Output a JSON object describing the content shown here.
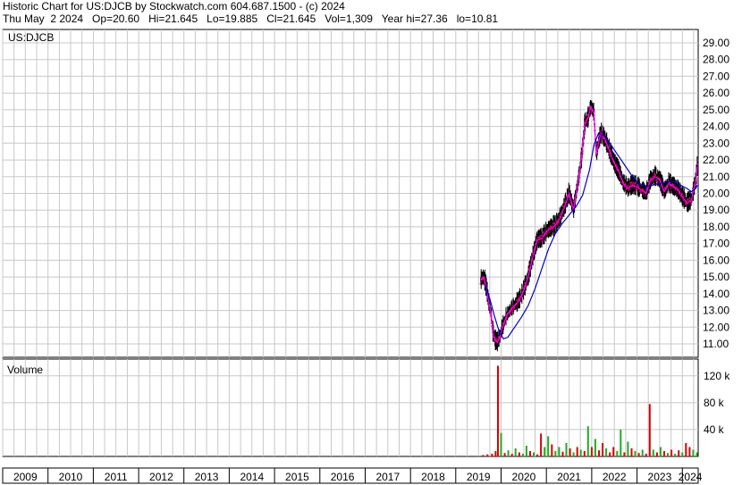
{
  "header": {
    "line1": "Historic Chart for US:DJCB by Stockwatch.com 604.687.1500 - (c) 2024",
    "line2": "Thu May  2 2024   Op=20.60   Hi=21.645   Lo=19.885   Cl=21.645   Vol=1,309   Year hi=27.36   lo=10.81"
  },
  "panels": {
    "price_label": "US:DJCB",
    "volume_label": "Volume"
  },
  "colors": {
    "grid": "#c8c8c8",
    "price_bars": "#000000",
    "close_dots": "#e8007a",
    "moving_avg_short": "#ff00ff",
    "moving_avg_long": "#0000cc",
    "volume_up": "#22aa22",
    "volume_down": "#dd0000"
  },
  "chart_data": [
    {
      "type": "line",
      "title": "",
      "ylabel": "",
      "ylim": [
        10.2,
        29.8
      ],
      "y_ticks": [
        "11.00",
        "12.00",
        "13.00",
        "14.00",
        "15.00",
        "16.00",
        "17.00",
        "18.00",
        "19.00",
        "20.00",
        "21.00",
        "22.00",
        "23.00",
        "24.00",
        "25.00",
        "26.00",
        "27.00",
        "28.00",
        "29.00"
      ],
      "x_ticks": [
        "2009",
        "2010",
        "2011",
        "2012",
        "2013",
        "2014",
        "2015",
        "2016",
        "2017",
        "2018",
        "2019",
        "2020",
        "2021",
        "2022",
        "2023",
        "2024"
      ],
      "xlim": [
        2009.0,
        2024.35
      ],
      "series": [
        {
          "x": [
            2019.55,
            2019.62,
            2019.68,
            2019.72,
            2019.78,
            2019.82,
            2019.87,
            2019.92,
            2019.97,
            2020.02,
            2020.07,
            2020.12,
            2020.2,
            2020.3,
            2020.4,
            2020.5,
            2020.6,
            2020.7,
            2020.8,
            2020.9,
            2021.0,
            2021.1,
            2021.2,
            2021.3,
            2021.4,
            2021.5,
            2021.6,
            2021.7,
            2021.78,
            2021.85,
            2021.92,
            2021.98,
            2022.05,
            2022.1,
            2022.15,
            2022.2,
            2022.3,
            2022.4,
            2022.5,
            2022.6,
            2022.7,
            2022.8,
            2022.9,
            2023.0,
            2023.1,
            2023.2,
            2023.3,
            2023.4,
            2023.5,
            2023.6,
            2023.7,
            2023.8,
            2023.9,
            2024.0,
            2024.1,
            2024.2,
            2024.3,
            2024.33
          ],
          "values": [
            14.8,
            15.0,
            14.3,
            13.6,
            12.8,
            11.7,
            11.2,
            11.1,
            11.4,
            11.9,
            12.3,
            12.7,
            13.0,
            13.3,
            13.6,
            14.2,
            15.0,
            16.2,
            17.2,
            17.3,
            17.7,
            17.9,
            18.1,
            18.5,
            19.2,
            20.0,
            19.0,
            20.7,
            22.2,
            24.2,
            24.5,
            25.2,
            24.8,
            22.3,
            23.0,
            23.6,
            23.2,
            22.5,
            21.8,
            21.3,
            20.6,
            20.3,
            20.5,
            20.4,
            20.2,
            20.0,
            20.8,
            21.0,
            20.8,
            20.1,
            20.6,
            20.4,
            20.2,
            19.8,
            19.4,
            19.6,
            20.8,
            21.6
          ]
        },
        {
          "x": [
            2019.65,
            2019.75,
            2019.85,
            2019.95,
            2020.05,
            2020.15,
            2020.3,
            2020.45,
            2020.6,
            2020.75,
            2020.9,
            2021.05,
            2021.2,
            2021.35,
            2021.5,
            2021.65,
            2021.8,
            2021.95,
            2022.05,
            2022.15,
            2022.3,
            2022.45,
            2022.6,
            2022.75,
            2022.9,
            2023.05,
            2023.2,
            2023.35,
            2023.5,
            2023.65,
            2023.8,
            2023.95,
            2024.1,
            2024.2,
            2024.3,
            2024.33
          ],
          "values": [
            14.5,
            13.7,
            12.7,
            11.8,
            11.3,
            11.4,
            12.0,
            12.6,
            13.3,
            14.3,
            15.5,
            16.7,
            17.6,
            18.2,
            18.7,
            19.2,
            19.9,
            21.4,
            22.9,
            23.6,
            23.4,
            22.8,
            22.2,
            21.6,
            21.0,
            20.6,
            20.4,
            20.5,
            20.6,
            20.7,
            20.7,
            20.5,
            20.3,
            20.1,
            20.3,
            20.5
          ]
        }
      ]
    },
    {
      "type": "bar",
      "title": "",
      "ylabel": "",
      "ylim": [
        0,
        145
      ],
      "y_ticks": [
        "40 k",
        "80 k",
        "120 k"
      ],
      "x": [
        2019.6,
        2019.7,
        2019.8,
        2019.88,
        2019.93,
        2020.0,
        2020.08,
        2020.16,
        2020.24,
        2020.32,
        2020.4,
        2020.48,
        2020.56,
        2020.64,
        2020.72,
        2020.8,
        2020.88,
        2020.96,
        2021.04,
        2021.12,
        2021.2,
        2021.28,
        2021.36,
        2021.44,
        2021.52,
        2021.6,
        2021.68,
        2021.76,
        2021.84,
        2021.92,
        2022.0,
        2022.08,
        2022.16,
        2022.24,
        2022.32,
        2022.4,
        2022.48,
        2022.56,
        2022.64,
        2022.72,
        2022.8,
        2022.88,
        2022.96,
        2023.04,
        2023.12,
        2023.2,
        2023.28,
        2023.36,
        2023.44,
        2023.52,
        2023.6,
        2023.68,
        2023.76,
        2023.84,
        2023.92,
        2024.0,
        2024.08,
        2024.16,
        2024.24,
        2024.32
      ],
      "values": [
        2,
        3,
        4,
        8,
        135,
        35,
        5,
        9,
        4,
        12,
        6,
        4,
        16,
        8,
        6,
        3,
        34,
        14,
        30,
        18,
        8,
        14,
        7,
        20,
        12,
        6,
        14,
        10,
        8,
        45,
        14,
        26,
        9,
        20,
        12,
        6,
        14,
        8,
        40,
        6,
        22,
        12,
        8,
        5,
        10,
        4,
        78,
        10,
        6,
        14,
        8,
        5,
        10,
        4,
        9,
        6,
        20,
        14,
        10,
        6
      ],
      "up": [
        false,
        false,
        false,
        false,
        false,
        true,
        false,
        true,
        false,
        true,
        false,
        true,
        true,
        false,
        true,
        false,
        false,
        true,
        true,
        false,
        true,
        true,
        false,
        true,
        false,
        true,
        false,
        true,
        false,
        true,
        false,
        true,
        false,
        false,
        true,
        false,
        false,
        true,
        true,
        false,
        true,
        false,
        true,
        false,
        true,
        false,
        false,
        true,
        false,
        true,
        false,
        true,
        false,
        true,
        false,
        true,
        false,
        false,
        true,
        true
      ]
    }
  ]
}
